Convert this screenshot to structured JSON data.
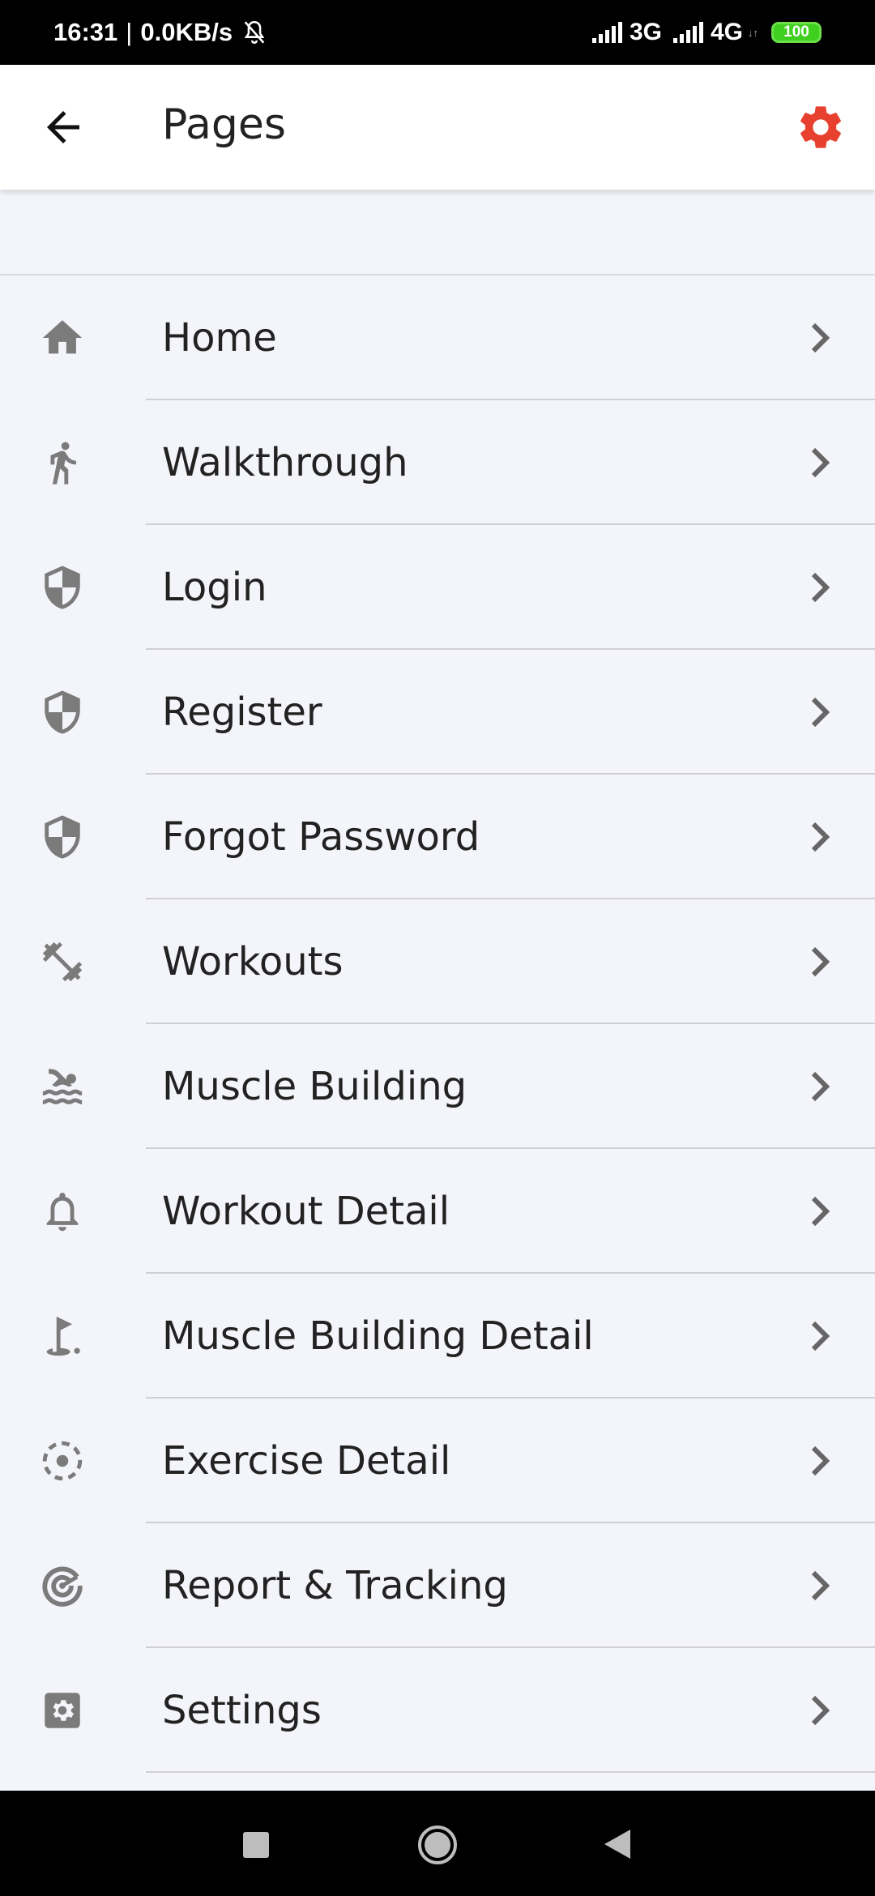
{
  "status_bar": {
    "time": "16:31",
    "separator": "|",
    "net_speed": "0.0KB/s",
    "network_1": "3G",
    "network_2": "4G",
    "sub_arrows": "↓↑",
    "battery": "100",
    "icons": [
      "bell-off-icon",
      "signal-icon",
      "signal-icon",
      "battery-icon"
    ],
    "battery_color": "#3fcf1e"
  },
  "app_bar": {
    "title": "Pages",
    "back_icon": "arrow-left-icon",
    "settings_icon": "gear-icon",
    "accent_color": "#e8402f"
  },
  "menu": {
    "items": [
      {
        "label": "Home",
        "icon": "home-icon"
      },
      {
        "label": "Walkthrough",
        "icon": "running-person-icon"
      },
      {
        "label": "Login",
        "icon": "shield-icon"
      },
      {
        "label": "Register",
        "icon": "shield-icon"
      },
      {
        "label": "Forgot Password",
        "icon": "shield-icon"
      },
      {
        "label": "Workouts",
        "icon": "dumbbell-icon"
      },
      {
        "label": "Muscle Building",
        "icon": "swimmer-icon"
      },
      {
        "label": "Workout Detail",
        "icon": "bell-icon"
      },
      {
        "label": "Muscle Building Detail",
        "icon": "golf-flag-icon"
      },
      {
        "label": "Exercise Detail",
        "icon": "target-dashed-icon"
      },
      {
        "label": "Report & Tracking",
        "icon": "radar-icon"
      },
      {
        "label": "Settings",
        "icon": "gear-box-icon"
      }
    ],
    "chevron_icon": "chevron-right-icon",
    "icon_color": "#7b7b7b"
  },
  "nav_bar": {
    "icons": [
      "recents-square-icon",
      "home-circle-icon",
      "back-triangle-icon"
    ]
  }
}
